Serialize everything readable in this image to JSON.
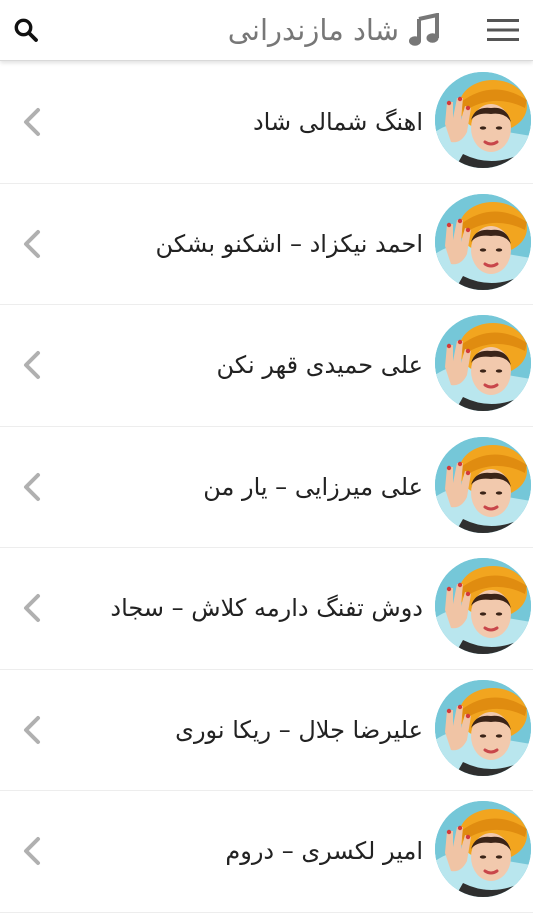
{
  "appbar": {
    "title": "شاد مازندرانی",
    "icons": {
      "search": "search-icon",
      "music": "music-note-icon",
      "menu": "hamburger-menu-icon"
    }
  },
  "list": {
    "items": [
      {
        "label": "اهنگ شمالی شاد"
      },
      {
        "label": "احمد نیکزاد – اشکنو بشکن"
      },
      {
        "label": "علی حمیدی قهر نکن"
      },
      {
        "label": "علی میرزایی – یار من"
      },
      {
        "label": "دوش تفنگ دارمه کلاش – سجاد"
      },
      {
        "label": "علیرضا جلال – ریکا نوری"
      },
      {
        "label": "امیر لکسری – دروم"
      }
    ]
  },
  "colors": {
    "title": "#777777",
    "text": "#222222",
    "chevron": "#b0b0b0",
    "avatar_bg": "#75c7d8",
    "hat": "#f2a51f"
  }
}
